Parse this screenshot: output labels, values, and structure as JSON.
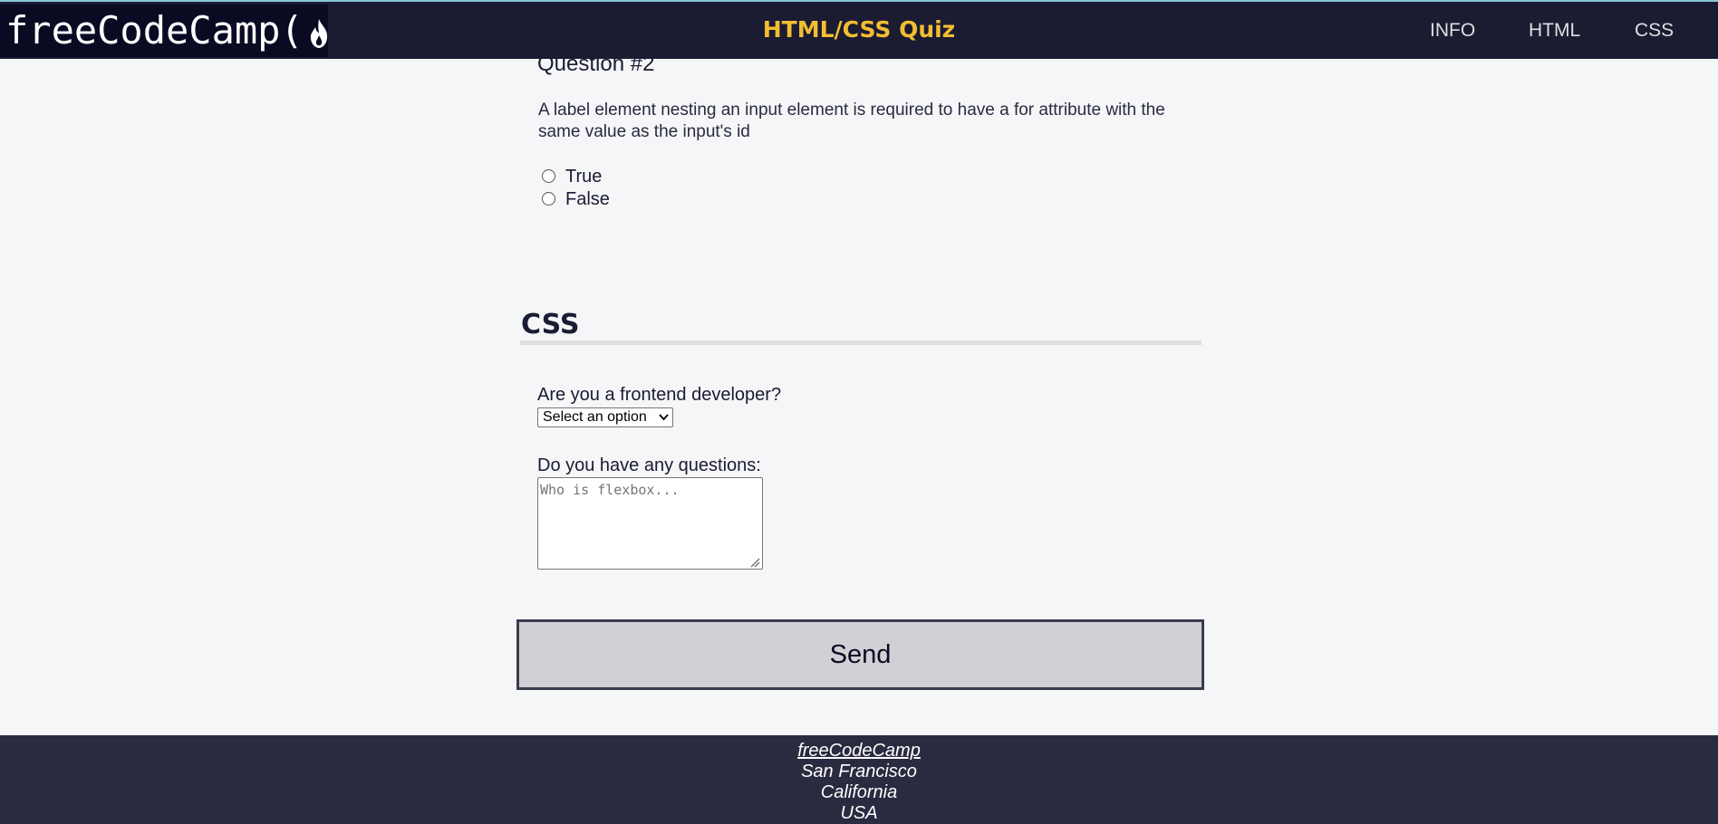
{
  "header": {
    "logo_text": "freeCodeCamp(",
    "logo_text_end": ")",
    "title": "HTML/CSS Quiz",
    "nav": [
      {
        "label": "INFO"
      },
      {
        "label": "HTML"
      },
      {
        "label": "CSS"
      }
    ]
  },
  "question": {
    "title": "Question #2",
    "text": "A label element nesting an input element is required to have a for attribute with the same value as the input's id",
    "options": [
      {
        "label": "True"
      },
      {
        "label": "False"
      }
    ]
  },
  "css_section": {
    "title": "CSS",
    "frontend_label": "Are you a frontend developer?",
    "frontend_select_value": "Select an option",
    "questions_label": "Do you have any questions:",
    "questions_placeholder": "Who is flexbox...",
    "send_label": "Send"
  },
  "footer": {
    "link": "freeCodeCamp",
    "lines": [
      "San Francisco",
      "California",
      "USA"
    ]
  },
  "colors": {
    "header_bg": "#1b1b32",
    "title_accent": "#f1be32",
    "page_bg": "#f5f6f7",
    "footer_bg": "#2a2a40",
    "button_bg": "#d0d0d5"
  }
}
